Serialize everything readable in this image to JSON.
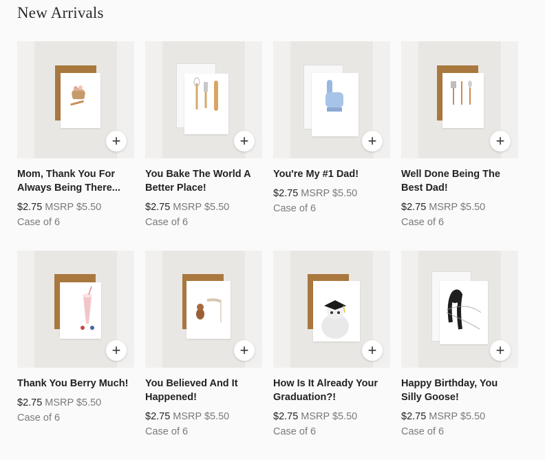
{
  "section": {
    "title": "New Arrivals"
  },
  "products": [
    {
      "name": "Mom, Thank You For Always Being There...",
      "price": "$2.75",
      "msrp": "MSRP $5.50",
      "case": "Case of 6",
      "icon": "plus-icon"
    },
    {
      "name": "You Bake The World A Better Place!",
      "price": "$2.75",
      "msrp": "MSRP $5.50",
      "case": "Case of 6",
      "icon": "plus-icon"
    },
    {
      "name": "You're My #1 Dad!",
      "price": "$2.75",
      "msrp": "MSRP $5.50",
      "case": "Case of 6",
      "icon": "plus-icon"
    },
    {
      "name": "Well Done Being The Best Dad!",
      "price": "$2.75",
      "msrp": "MSRP $5.50",
      "case": "Case of 6",
      "icon": "plus-icon"
    },
    {
      "name": "Thank You Berry Much!",
      "price": "$2.75",
      "msrp": "MSRP $5.50",
      "case": "Case of 6",
      "icon": "plus-icon"
    },
    {
      "name": "You Believed And It Happened!",
      "price": "$2.75",
      "msrp": "MSRP $5.50",
      "case": "Case of 6",
      "icon": "plus-icon"
    },
    {
      "name": "How Is It Already Your Graduation?!",
      "price": "$2.75",
      "msrp": "MSRP $5.50",
      "case": "Case of 6",
      "icon": "plus-icon"
    },
    {
      "name": "Happy Birthday, You Silly Goose!",
      "price": "$2.75",
      "msrp": "MSRP $5.50",
      "case": "Case of 6",
      "icon": "plus-icon"
    }
  ],
  "colors": {
    "kraft_envelope": "#a9783f",
    "background": "#fafafa",
    "muted_text": "#7a7a7a"
  }
}
